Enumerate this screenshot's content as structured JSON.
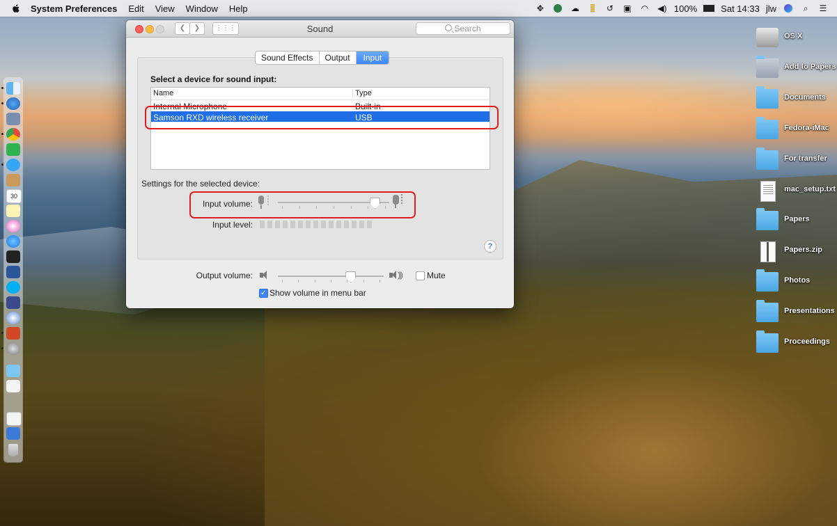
{
  "menubar": {
    "app": "System Preferences",
    "items": [
      "Edit",
      "View",
      "Window",
      "Help"
    ],
    "battery": "100%",
    "clock": "Sat 14:33",
    "user": "jlw"
  },
  "window": {
    "title": "Sound",
    "search_placeholder": "Search",
    "tabs": [
      {
        "label": "Sound Effects",
        "active": false
      },
      {
        "label": "Output",
        "active": false
      },
      {
        "label": "Input",
        "active": true
      }
    ],
    "select_label": "Select a device for sound input:",
    "table": {
      "headers": [
        "Name",
        "Type"
      ],
      "rows": [
        {
          "name": "Internal Microphone",
          "type": "Built-in",
          "selected": false
        },
        {
          "name": "Samson RXD wireless receiver",
          "type": "USB",
          "selected": true
        }
      ]
    },
    "settings_label": "Settings for the selected device:",
    "input_volume_label": "Input volume:",
    "input_volume_value": 0.9,
    "input_level_label": "Input level:",
    "input_level_bars": 15,
    "help": "?",
    "output_volume_label": "Output volume:",
    "output_volume_value": 0.7,
    "mute_label": "Mute",
    "mute_checked": false,
    "show_volume_label": "Show volume in menu bar",
    "show_volume_checked": true
  },
  "desktop_icons": [
    {
      "label": "OS X",
      "kind": "drive"
    },
    {
      "label": "Add to Papers",
      "kind": "folder-gray"
    },
    {
      "label": "Documents",
      "kind": "folder"
    },
    {
      "label": "Fedora-iMac",
      "kind": "folder"
    },
    {
      "label": "For transfer",
      "kind": "folder"
    },
    {
      "label": "mac_setup.txt",
      "kind": "doc"
    },
    {
      "label": "Papers",
      "kind": "folder"
    },
    {
      "label": "Papers.zip",
      "kind": "zip"
    },
    {
      "label": "Photos",
      "kind": "folder"
    },
    {
      "label": "Presentations",
      "kind": "folder"
    },
    {
      "label": "Proceedings",
      "kind": "folder"
    }
  ],
  "colors": {
    "accent": "#3e86f5",
    "selection": "#1f6ee6",
    "highlight_box": "#e21b1b"
  }
}
